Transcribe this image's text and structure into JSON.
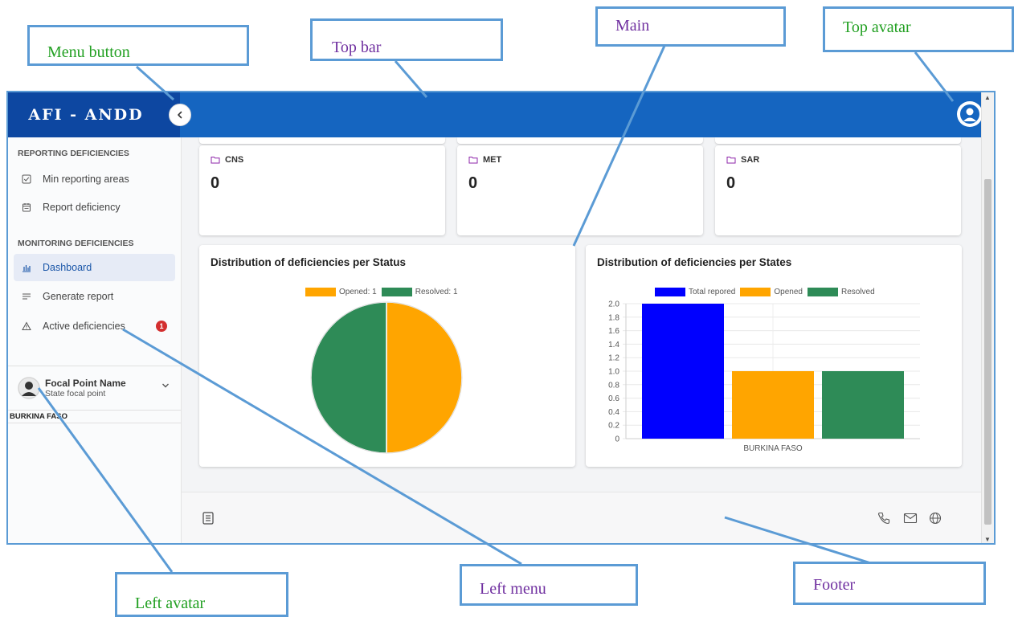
{
  "app": {
    "title": "AFI - ANDD",
    "menu_button_icon": "chevron-left-icon",
    "top_avatar_icon": "user-avatar-icon",
    "brand_color": "#1565c0",
    "brand_dark_color": "#0d47a1"
  },
  "sidebar": {
    "sections": [
      {
        "title": "REPORTING DEFICIENCIES",
        "items": [
          {
            "label": "Min reporting areas",
            "icon": "checkbox-icon"
          },
          {
            "label": "Report deficiency",
            "icon": "calendar-icon"
          }
        ]
      },
      {
        "title": "MONITORING DEFICIENCIES",
        "items": [
          {
            "label": "Dashboard",
            "icon": "bar-chart-icon",
            "active": true
          },
          {
            "label": "Generate report",
            "icon": "lines-icon"
          },
          {
            "label": "Active deficiencies",
            "icon": "warning-icon",
            "badge": "1"
          }
        ]
      }
    ],
    "profile": {
      "name": "Focal Point Name",
      "role": "State focal point",
      "state": "BURKINA FASO"
    }
  },
  "stats": [
    {
      "label": "CNS",
      "value": "0"
    },
    {
      "label": "MET",
      "value": "0"
    },
    {
      "label": "SAR",
      "value": "0"
    }
  ],
  "charts": {
    "status_title": "Distribution of deficiencies per Status",
    "states_title": "Distribution of deficiencies per States"
  },
  "chart_data": [
    {
      "type": "pie",
      "title": "Distribution of deficiencies per Status",
      "legend_position": "top",
      "slices": [
        {
          "name": "Opened: 1",
          "value": 1,
          "color": "#ffa500"
        },
        {
          "name": "Resolved: 1",
          "value": 1,
          "color": "#2e8b57"
        }
      ]
    },
    {
      "type": "bar",
      "title": "Distribution of deficiencies per States",
      "legend_position": "top",
      "categories": [
        "BURKINA FASO"
      ],
      "series": [
        {
          "name": "Total repored",
          "values": [
            2
          ],
          "color": "#0000ff"
        },
        {
          "name": "Opened",
          "values": [
            1
          ],
          "color": "#ffa500"
        },
        {
          "name": "Resolved",
          "values": [
            1
          ],
          "color": "#2e8b57"
        }
      ],
      "ylim": [
        0,
        2.0
      ],
      "yticks": [
        "2.0",
        "1.8",
        "1.6",
        "1.4",
        "1.2",
        "1.0",
        "0.8",
        "0.6",
        "0.4",
        "0.2",
        "0"
      ],
      "grid": true
    }
  ],
  "footer": {
    "left_icon": "document-icon",
    "right_icons": [
      "phone-icon",
      "mail-icon",
      "globe-icon"
    ]
  },
  "annotations": {
    "menu_button": "Menu button",
    "top_bar": "Top bar",
    "main": "Main",
    "top_avatar": "Top avatar",
    "left_avatar": "Left avatar",
    "left_menu": "Left menu",
    "footer": "Footer"
  }
}
